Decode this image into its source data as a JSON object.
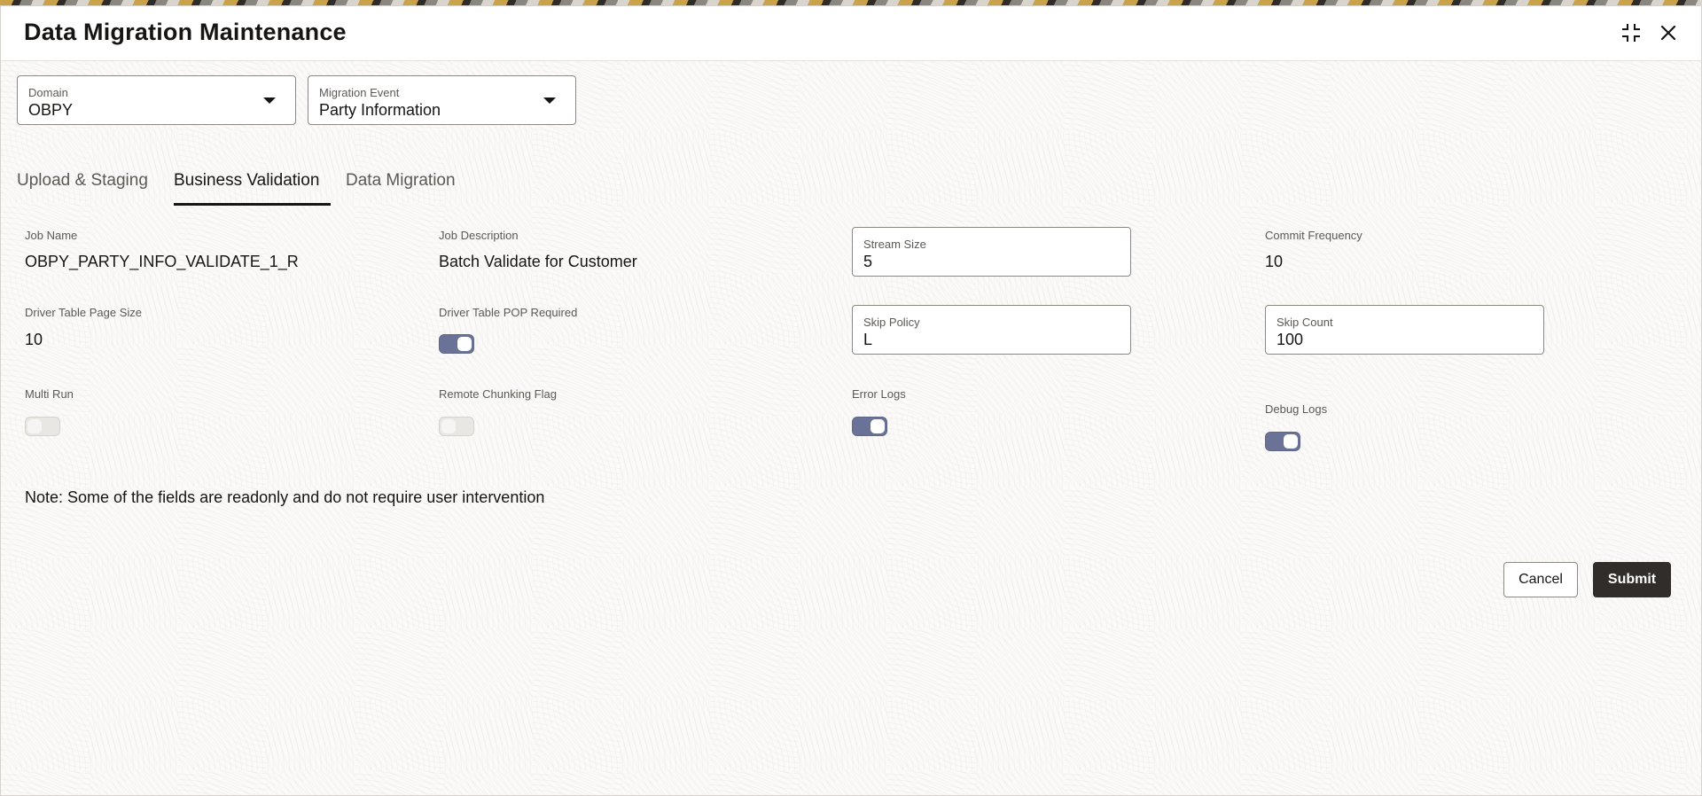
{
  "dialog": {
    "title": "Data Migration Maintenance",
    "icons": [
      "compress-icon",
      "close-icon"
    ]
  },
  "filters": {
    "domain": {
      "label": "Domain",
      "value": "OBPY"
    },
    "migration_event": {
      "label": "Migration Event",
      "value": "Party Information"
    }
  },
  "tabs": [
    {
      "label": "Upload & Staging",
      "active": false
    },
    {
      "label": "Business Validation",
      "active": true
    },
    {
      "label": "Data Migration",
      "active": false
    }
  ],
  "fields": {
    "job_name": {
      "label": "Job Name",
      "value": "OBPY_PARTY_INFO_VALIDATE_1_R"
    },
    "job_description": {
      "label": "Job Description",
      "value": "Batch Validate for Customer"
    },
    "stream_size": {
      "label": "Stream Size",
      "value": "5"
    },
    "commit_frequency": {
      "label": "Commit Frequency",
      "value": "10"
    },
    "driver_table_page_size": {
      "label": "Driver Table Page Size",
      "value": "10"
    },
    "driver_table_pop_required": {
      "label": "Driver Table POP Required",
      "on": true
    },
    "skip_policy": {
      "label": "Skip Policy",
      "value": "L"
    },
    "skip_count": {
      "label": "Skip Count",
      "value": "100"
    },
    "multi_run": {
      "label": "Multi Run",
      "on": false
    },
    "remote_chunking_flag": {
      "label": "Remote Chunking Flag",
      "on": false
    },
    "error_logs": {
      "label": "Error Logs",
      "on": true
    },
    "debug_logs": {
      "label": "Debug Logs",
      "on": true
    }
  },
  "note": "Note: Some of the fields are readonly and do not require user intervention",
  "actions": {
    "cancel_label": "Cancel",
    "submit_label": "Submit"
  },
  "colors": {
    "toggle_on": "#6b7297",
    "submit_bg": "#312d2a"
  }
}
